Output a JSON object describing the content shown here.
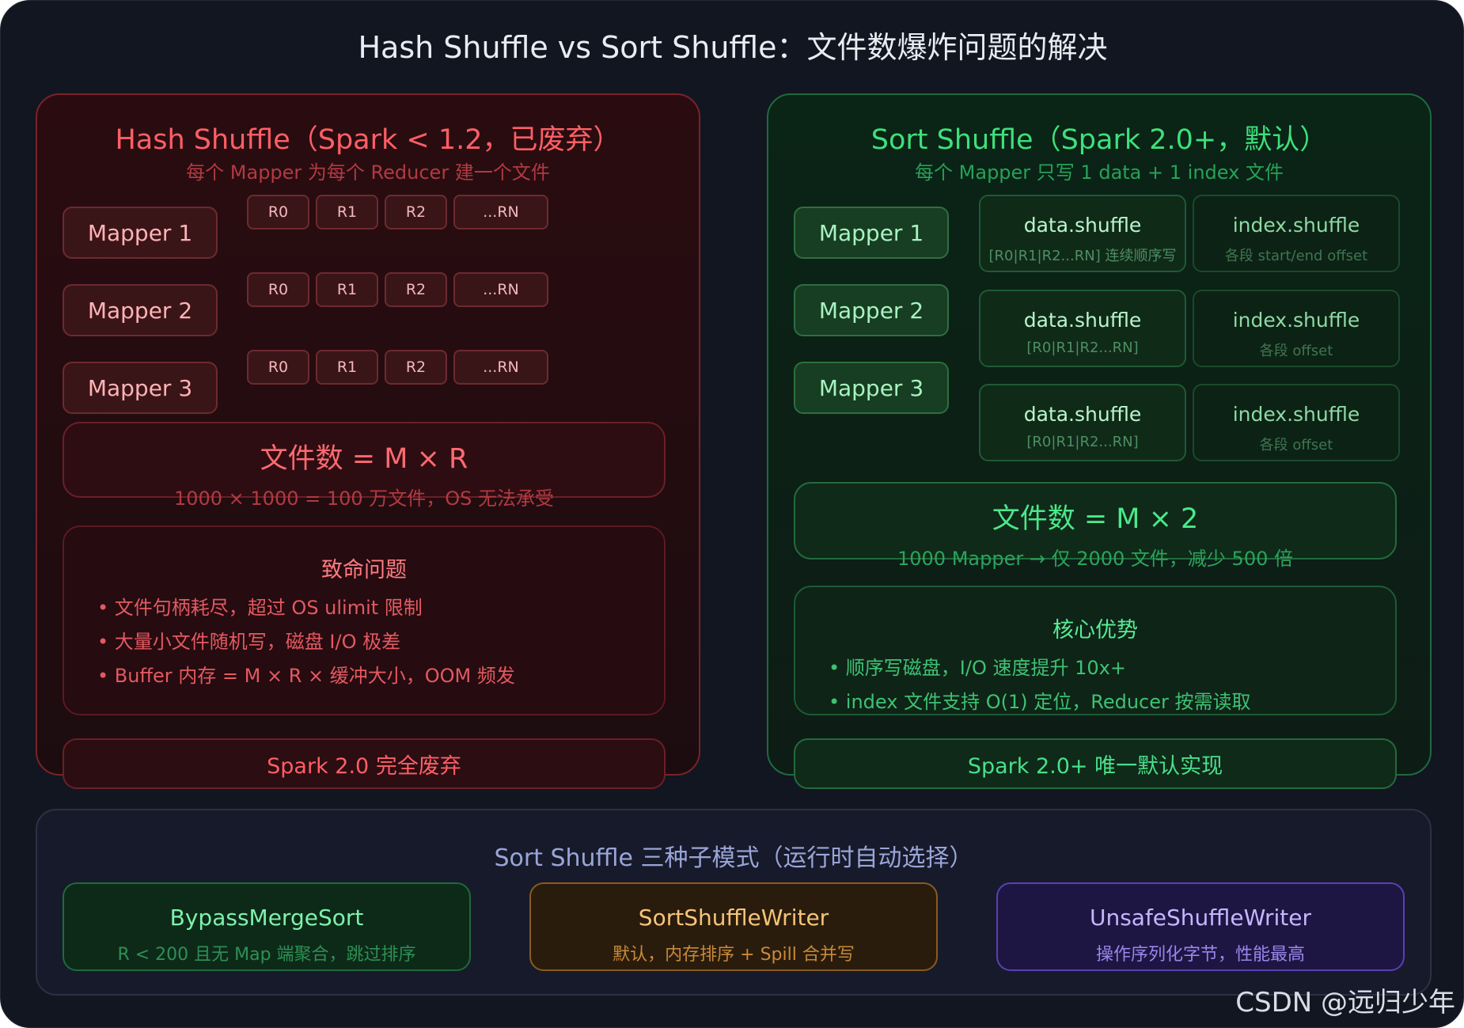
{
  "title": "Hash Shuffle vs Sort Shuffle：文件数爆炸问题的解决",
  "hash": {
    "heading": "Hash Shuffle（Spark < 1.2，已废弃）",
    "subheading": "每个 Mapper 为每个 Reducer 建一个文件",
    "mappers": [
      "Mapper 1",
      "Mapper 2",
      "Mapper 3"
    ],
    "reducer_files": [
      "R0",
      "R1",
      "R2",
      "...RN"
    ],
    "count_title": "文件数 = M × R",
    "count_note": "1000 × 1000 = 100 万文件，OS 无法承受",
    "issues_title": "致命问题",
    "issues": [
      "文件句柄耗尽，超过 OS ulimit 限制",
      "大量小文件随机写，磁盘 I/O 极差",
      "Buffer 内存 = M × R × 缓冲大小，OOM 频发"
    ],
    "footer": "Spark 2.0 完全废弃"
  },
  "sort": {
    "heading": "Sort Shuffle（Spark 2.0+，默认）",
    "subheading": "每个 Mapper 只写 1 data + 1 index 文件",
    "mappers": [
      "Mapper 1",
      "Mapper 2",
      "Mapper 3"
    ],
    "files": [
      {
        "data": "data.shuffle",
        "data_note": "[R0|R1|R2...RN] 连续顺序写",
        "index": "index.shuffle",
        "index_note": "各段 start/end offset"
      },
      {
        "data": "data.shuffle",
        "data_note": "[R0|R1|R2...RN]",
        "index": "index.shuffle",
        "index_note": "各段 offset"
      },
      {
        "data": "data.shuffle",
        "data_note": "[R0|R1|R2...RN]",
        "index": "index.shuffle",
        "index_note": "各段 offset"
      }
    ],
    "count_title": "文件数 = M × 2",
    "count_note": "1000 Mapper → 仅 2000 文件，减少 500 倍",
    "adv_title": "核心优势",
    "advantages": [
      "顺序写磁盘，I/O 速度提升 10x+",
      "index 文件支持 O(1) 定位，Reducer 按需读取"
    ],
    "footer": "Spark 2.0+ 唯一默认实现"
  },
  "modes": {
    "title": "Sort Shuffle 三种子模式（运行时自动选择）",
    "items": [
      {
        "name": "BypassMergeSort",
        "desc": "R < 200 且无 Map 端聚合，跳过排序"
      },
      {
        "name": "SortShuffleWriter",
        "desc": "默认，内存排序 + Spill 合并写"
      },
      {
        "name": "UnsafeShuffleWriter",
        "desc": "操作序列化字节，性能最高"
      }
    ]
  },
  "watermark": "CSDN @远归少年"
}
